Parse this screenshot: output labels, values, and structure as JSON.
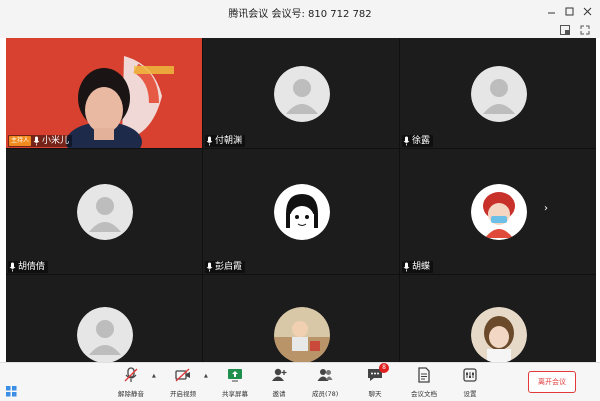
{
  "window": {
    "title": "腾讯会议  会议号: 810 712 782"
  },
  "participants": [
    {
      "name": "小米儿",
      "role_badge": "主持人",
      "type": "video"
    },
    {
      "name": "付朝渊",
      "type": "default-avatar"
    },
    {
      "name": "徐露",
      "type": "default-avatar"
    },
    {
      "name": "胡倩倩",
      "type": "default-avatar"
    },
    {
      "name": "彭启霞",
      "type": "cartoon-avatar"
    },
    {
      "name": "胡蝶",
      "type": "doll-avatar"
    },
    {
      "name": "",
      "type": "default-avatar"
    },
    {
      "name": "",
      "type": "photo-avatar"
    },
    {
      "name": "",
      "type": "photo-avatar"
    }
  ],
  "toolbar": {
    "mute_label": "解除静音",
    "video_label": "开启视频",
    "share_label": "共享屏幕",
    "invite_label": "邀请",
    "members_label": "成员(78)",
    "chat_label": "聊天",
    "chat_badge": "8",
    "docs_label": "会议文档",
    "settings_label": "设置",
    "leave_label": "离开会议"
  },
  "icons": {
    "minimize": "minimize-icon",
    "maximize": "maximize-icon",
    "close": "close-icon",
    "layout": "layout-icon",
    "fullscreen": "fullscreen-icon",
    "grid": "grid-view-icon",
    "next_page": "chevron-right-icon"
  },
  "colors": {
    "host_badge": "#f08a1e",
    "leave": "#e03a3a",
    "tile_bg": "#1c1c1c",
    "chat_badge": "#e02020"
  }
}
